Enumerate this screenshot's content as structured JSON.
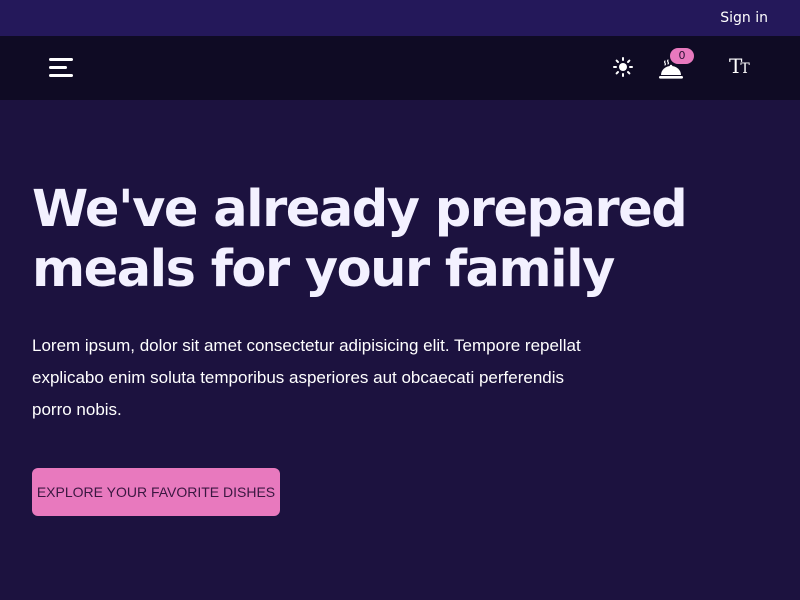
{
  "topbar": {
    "sign_in_label": "Sign in"
  },
  "navbar": {
    "menu_icon": "hamburger-icon",
    "theme_icon": "sun-icon",
    "cart_icon": "serving-dish-icon",
    "cart_count": "0",
    "text_size_icon": "text-size-icon",
    "text_size_big": "T",
    "text_size_small": "T"
  },
  "hero": {
    "title": "We've already prepared meals for your family",
    "description": "Lorem ipsum, dolor sit amet consectetur adipisicing elit. Tempore repellat explicabo enim soluta temporibus asperiores aut obcaecati perferendis porro nobis.",
    "cta_label": "EXPLORE YOUR FAVORITE DISHES"
  },
  "colors": {
    "background": "#1c123f",
    "topbar": "#24185a",
    "navbar": "#0f0b24",
    "accent": "#e879be",
    "heading": "#f3f1ff"
  }
}
